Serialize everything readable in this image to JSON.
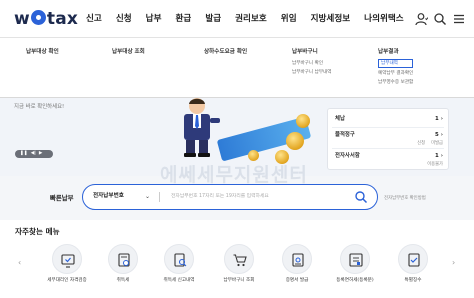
{
  "logo": {
    "pre": "w",
    "post": "tax"
  },
  "nav": {
    "items": [
      "신고",
      "신청",
      "납부",
      "환급",
      "발급",
      "권리보호",
      "위임",
      "지방세정보",
      "나의위택스"
    ]
  },
  "icons": {
    "user": "user-icon",
    "search": "search-icon",
    "menu": "hamburger-menu-icon"
  },
  "mega_menu": {
    "col1": {
      "heading": "납부대상 확인"
    },
    "col2": {
      "heading": "납부대상 조회"
    },
    "col3": {
      "heading": "상하수도요금 확인"
    },
    "col4": {
      "heading": "납부바구니",
      "items": [
        "납부바구니 확인",
        "납부바구니 납부내역"
      ]
    },
    "col5": {
      "heading": "납부결과",
      "items": [
        "납부내역",
        "예약납부 결과확인",
        "납부영수증 보관함"
      ]
    }
  },
  "hero": {
    "text": "지금 바로 확인하세요!",
    "slide_separator": "|"
  },
  "info_box": {
    "row1": {
      "label": "체납",
      "count": "1"
    },
    "row2": {
      "label": "물적정구",
      "count": "5"
    },
    "row2_sub": [
      "신청",
      "미발급"
    ],
    "row3": {
      "label": "전자사서함",
      "count": "1"
    },
    "row3_sub": [
      "이용불가"
    ]
  },
  "watermark": "에쎄세무지원센터",
  "quick_pay": {
    "label": "빠른납부",
    "select_value": "전자납부번호",
    "placeholder": "전자납부번호 17자리 또는 19자리를 입력하세요",
    "help": "전자납부번호 확인방법"
  },
  "frequent": {
    "title": "자주찾는 메뉴",
    "items": [
      {
        "label": "세무대리인 자격검증",
        "icon": "certificate-check-icon"
      },
      {
        "label": "취득세",
        "icon": "document-icon"
      },
      {
        "label": "취득세 신고내역",
        "icon": "document-search-icon"
      },
      {
        "label": "납부바구니 조회",
        "icon": "cart-icon"
      },
      {
        "label": "증명서 발급",
        "icon": "certificate-icon"
      },
      {
        "label": "등록면허세(등록분)",
        "icon": "registration-icon"
      },
      {
        "label": "특별징수",
        "icon": "special-collection-icon"
      }
    ]
  },
  "colors": {
    "accent": "#2b62d8",
    "navy": "#1d2a4e",
    "hero_bg": "#f1f4f9"
  }
}
